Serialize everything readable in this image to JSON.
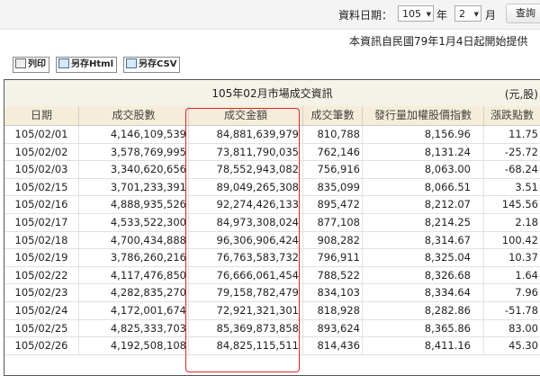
{
  "query": {
    "date_label": "資料日期：",
    "year_value": "105",
    "year_unit": "年",
    "month_value": "2",
    "month_unit": "月",
    "query_button": "查詢"
  },
  "notice": "本資訊自民國79年1月4日起開始提供",
  "toolbar": {
    "print_label": "列印",
    "save_html_label": "另存Html",
    "save_csv_label": "另存CSV"
  },
  "table": {
    "title": "105年02月市場成交資訊",
    "unit": "(元,股)",
    "headers": [
      "日期",
      "成交股數",
      "成交金額",
      "成交筆數",
      "發行量加權股價指數",
      "漲跌點數"
    ],
    "rows": [
      [
        "105/02/01",
        "4,146,109,539",
        "84,881,639,979",
        "810,788",
        "8,156.96",
        "11.75"
      ],
      [
        "105/02/02",
        "3,578,769,995",
        "73,811,790,035",
        "762,146",
        "8,131.24",
        "-25.72"
      ],
      [
        "105/02/03",
        "3,340,620,656",
        "78,552,943,082",
        "756,916",
        "8,063.00",
        "-68.24"
      ],
      [
        "105/02/15",
        "3,701,233,391",
        "89,049,265,308",
        "835,099",
        "8,066.51",
        "3.51"
      ],
      [
        "105/02/16",
        "4,888,935,526",
        "92,274,426,133",
        "895,472",
        "8,212.07",
        "145.56"
      ],
      [
        "105/02/17",
        "4,533,522,300",
        "84,973,308,024",
        "877,108",
        "8,214.25",
        "2.18"
      ],
      [
        "105/02/18",
        "4,700,434,888",
        "96,306,906,424",
        "908,282",
        "8,314.67",
        "100.42"
      ],
      [
        "105/02/19",
        "3,786,260,216",
        "76,763,583,732",
        "796,911",
        "8,325.04",
        "10.37"
      ],
      [
        "105/02/22",
        "4,117,476,850",
        "76,666,061,454",
        "788,522",
        "8,326.68",
        "1.64"
      ],
      [
        "105/02/23",
        "4,282,835,270",
        "79,158,782,479",
        "834,103",
        "8,334.64",
        "7.96"
      ],
      [
        "105/02/24",
        "4,172,001,674",
        "72,921,321,301",
        "818,928",
        "8,282.86",
        "-51.78"
      ],
      [
        "105/02/25",
        "4,825,333,703",
        "85,369,873,858",
        "893,624",
        "8,365.86",
        "83.00"
      ],
      [
        "105/02/26",
        "4,192,508,108",
        "84,825,115,511",
        "814,436",
        "8,411.16",
        "45.30"
      ]
    ]
  },
  "colors": {
    "highlight": "#d7262d",
    "title_bg": "#f5f2e8",
    "header_bg": "#f5edd8"
  }
}
